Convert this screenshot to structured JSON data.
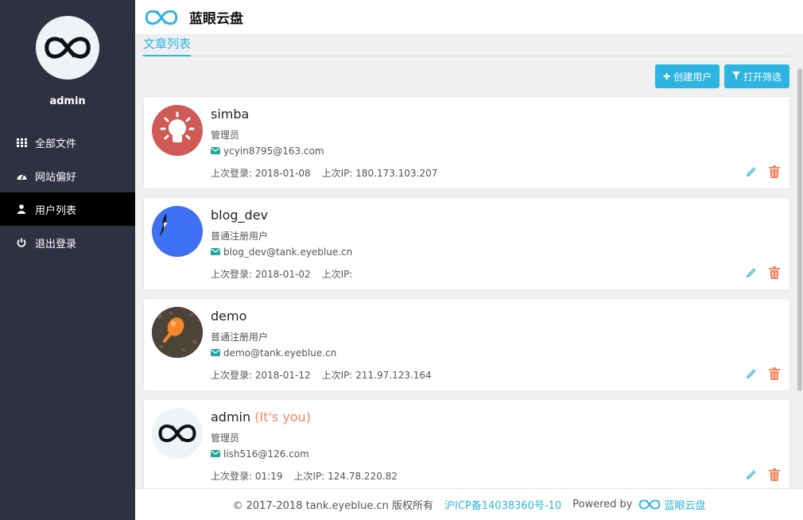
{
  "colors": {
    "sidebar_bg": "#2f3042",
    "accent": "#2bb5e0",
    "you_highlight": "#f4845f",
    "delete": "#f4845f",
    "edit": "#5bc0de",
    "mail": "#26a69a"
  },
  "sidebar": {
    "username": "admin",
    "items": [
      {
        "label": "全部文件",
        "icon": "grid-icon",
        "active": false
      },
      {
        "label": "网站偏好",
        "icon": "dashboard-icon",
        "active": false
      },
      {
        "label": "用户列表",
        "icon": "user-icon",
        "active": true
      },
      {
        "label": "退出登录",
        "icon": "power-icon",
        "active": false
      }
    ]
  },
  "header": {
    "title": "蓝眼云盘",
    "logo": "infinity-logo-icon"
  },
  "tabs": {
    "active": "文章列表"
  },
  "toolbar": {
    "create_label": "创建用户",
    "create_icon": "plus-icon",
    "filter_label": "打开筛选",
    "filter_icon": "filter-icon"
  },
  "users": [
    {
      "name": "simba",
      "you": "",
      "role": "管理员",
      "email": "ycyin8795@163.com",
      "login_label": "上次登录:",
      "last_login": "2018-01-08",
      "ip_label": "上次IP:",
      "last_ip": "180.173.103.207",
      "avatar": "lightbulb-avatar"
    },
    {
      "name": "blog_dev",
      "you": "",
      "role": "普通注册用户",
      "email": "blog_dev@tank.eyeblue.cn",
      "login_label": "上次登录:",
      "last_login": "2018-01-02",
      "ip_label": "上次IP:",
      "last_ip": "",
      "avatar": "blue-bird-avatar"
    },
    {
      "name": "demo",
      "you": "",
      "role": "普通注册用户",
      "email": "demo@tank.eyeblue.cn",
      "login_label": "上次登录:",
      "last_login": "2018-01-12",
      "ip_label": "上次IP:",
      "last_ip": "211.97.123.164",
      "avatar": "orange-balloon-avatar"
    },
    {
      "name": "admin",
      "you": "(It's you)",
      "role": "管理员",
      "email": "lish516@126.com",
      "login_label": "上次登录:",
      "last_login": "01:19",
      "ip_label": "上次IP:",
      "last_ip": "124.78.220.82",
      "avatar": "infinity-logo-avatar"
    }
  ],
  "footer": {
    "copyright": "© 2017-2018 tank.eyeblue.cn 版权所有",
    "icp": "沪ICP备14038360号-10",
    "powered_by": "Powered by",
    "brand": "蓝眼云盘"
  }
}
